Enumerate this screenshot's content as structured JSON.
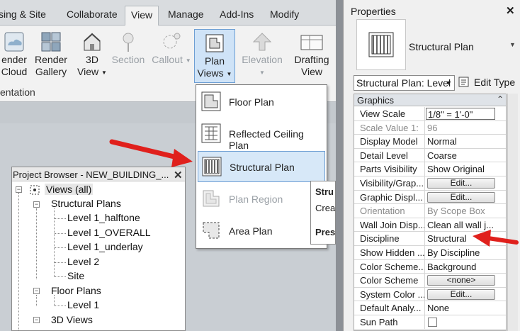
{
  "ribbon": {
    "tabs": [
      "sing & Site",
      "Collaborate",
      "View",
      "Manage",
      "Add-Ins",
      "Modify"
    ],
    "active_tab": "View",
    "buttons": {
      "render_cloud": [
        "ender",
        "Cloud"
      ],
      "render_gallery": [
        "Render",
        "Gallery"
      ],
      "three_d_view": [
        "3D",
        "View"
      ],
      "section": "Section",
      "callout": "Callout",
      "plan_views": [
        "Plan",
        "Views"
      ],
      "elevation": "Elevation",
      "drafting_view": [
        "Drafting",
        "View"
      ]
    },
    "group_label": "entation"
  },
  "plan_views_menu": {
    "items": [
      {
        "label": "Floor Plan",
        "enabled": true
      },
      {
        "label": "Reflected Ceiling Plan",
        "enabled": true
      },
      {
        "label": "Structural Plan",
        "enabled": true,
        "highlighted": true
      },
      {
        "label": "Plan Region",
        "enabled": false
      },
      {
        "label": "Area Plan",
        "enabled": true
      }
    ]
  },
  "tooltip_fragment": [
    "Stru",
    "Crea",
    "Pres"
  ],
  "project_browser": {
    "title": "Project Browser - NEW_BUILDING_...",
    "close": "✕",
    "root": "Views (all)",
    "groups": [
      {
        "label": "Structural Plans",
        "children": [
          "Level 1_halftone",
          "Level 1_OVERALL",
          "Level 1_underlay",
          "Level 2",
          "Site"
        ]
      },
      {
        "label": "Floor Plans",
        "children": [
          "Level 1"
        ]
      },
      {
        "label": "3D Views",
        "children": []
      }
    ]
  },
  "properties": {
    "title": "Properties",
    "close": "✕",
    "type_name": "Structural Plan",
    "type_selector": "Structural Plan: Level",
    "edit_type": "Edit Type",
    "group": "Graphics",
    "group_toggle": "⌃⌃",
    "rows": [
      {
        "name": "View Scale",
        "value": "1/8\" = 1'-0\"",
        "kind": "input"
      },
      {
        "name": "Scale Value    1:",
        "value": "96",
        "kind": "text",
        "disabled": true
      },
      {
        "name": "Display Model",
        "value": "Normal",
        "kind": "text"
      },
      {
        "name": "Detail Level",
        "value": "Coarse",
        "kind": "text"
      },
      {
        "name": "Parts Visibility",
        "value": "Show Original",
        "kind": "text"
      },
      {
        "name": "Visibility/Grap...",
        "value": "Edit...",
        "kind": "button"
      },
      {
        "name": "Graphic Displ...",
        "value": "Edit...",
        "kind": "button"
      },
      {
        "name": "Orientation",
        "value": "By Scope Box",
        "kind": "text",
        "disabled": true
      },
      {
        "name": "Wall Join Disp...",
        "value": "Clean all wall j...",
        "kind": "text"
      },
      {
        "name": "Discipline",
        "value": "Structural",
        "kind": "text"
      },
      {
        "name": "Show Hidden ...",
        "value": "By Discipline",
        "kind": "text"
      },
      {
        "name": "Color Scheme...",
        "value": "Background",
        "kind": "text"
      },
      {
        "name": "Color Scheme",
        "value": "<none>",
        "kind": "button"
      },
      {
        "name": "System Color ...",
        "value": "Edit...",
        "kind": "button"
      },
      {
        "name": "Default Analy...",
        "value": "None",
        "kind": "text"
      },
      {
        "name": "Sun Path",
        "value": "",
        "kind": "checkbox"
      }
    ]
  },
  "colors": {
    "annotation_arrow": "#e0201c",
    "highlight": "#d7e8f8",
    "highlight_border": "#6e9fd4"
  }
}
